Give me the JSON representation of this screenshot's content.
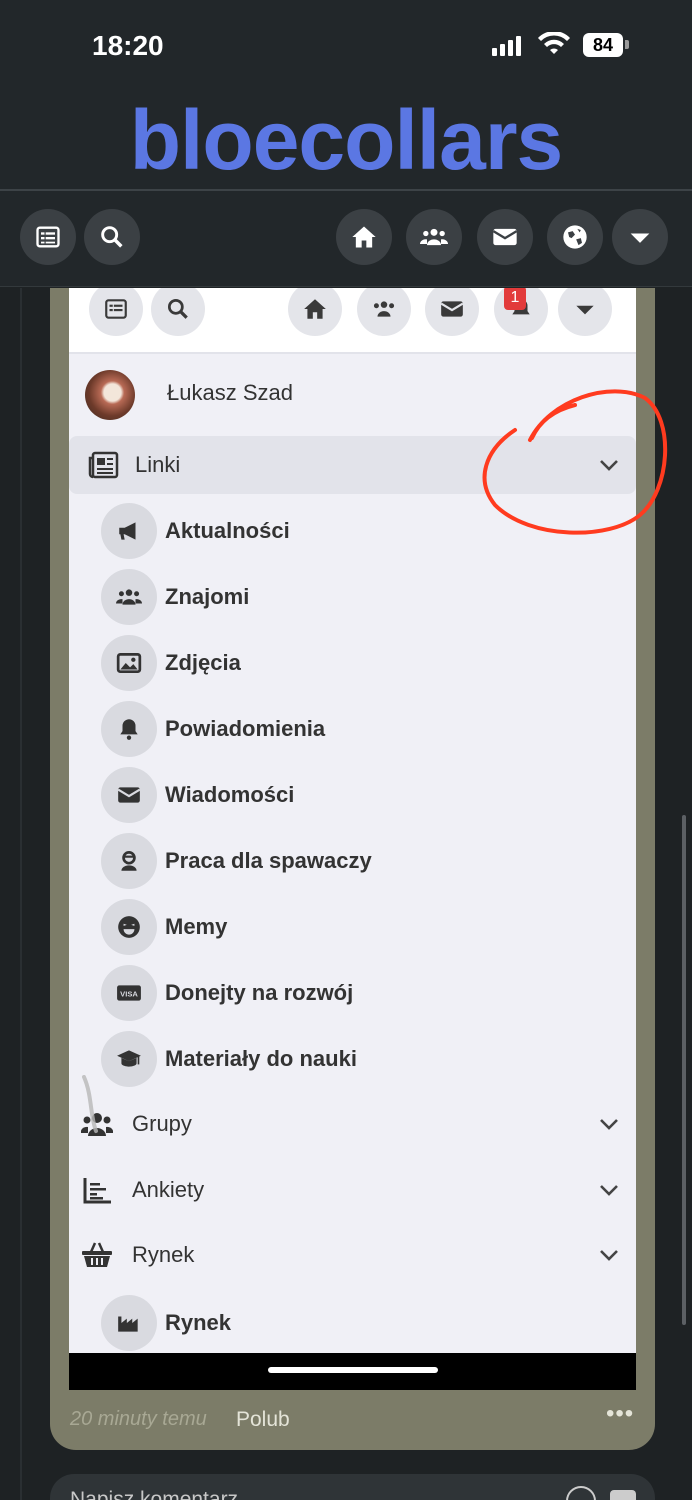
{
  "status_bar": {
    "time": "18:20",
    "battery": "84"
  },
  "brand": {
    "logo_text": "bloecollars",
    "color": "#5b77e3"
  },
  "top_nav": {
    "icons": [
      "list-icon",
      "search-icon",
      "home-icon",
      "friends-icon",
      "mail-icon",
      "globe-icon",
      "caret-down-icon"
    ]
  },
  "inner_nav": {
    "notification_badge": "1"
  },
  "profile": {
    "name": "Łukasz Szad"
  },
  "sections": {
    "linki": "Linki",
    "grupy": "Grupy",
    "ankiety": "Ankiety",
    "rynek": "Rynek"
  },
  "linki_items": [
    {
      "label": "Aktualności",
      "icon": "megaphone-icon"
    },
    {
      "label": "Znajomi",
      "icon": "friends-icon"
    },
    {
      "label": "Zdjęcia",
      "icon": "image-icon"
    },
    {
      "label": "Powiadomienia",
      "icon": "bell-icon"
    },
    {
      "label": "Wiadomości",
      "icon": "mail-icon"
    },
    {
      "label": "Praca dla spawaczy",
      "icon": "worker-icon"
    },
    {
      "label": "Memy",
      "icon": "laugh-icon"
    },
    {
      "label": "Donejty na rozwój",
      "icon": "visa-card-icon"
    },
    {
      "label": "Materiały do nauki",
      "icon": "graduation-cap-icon"
    }
  ],
  "rynek_items": [
    {
      "label": "Rynek",
      "icon": "factory-icon"
    }
  ],
  "post_meta": {
    "time": "20 minuty temu",
    "like": "Polub",
    "more": "•••"
  },
  "comment": {
    "placeholder": "Napisz komentarz..."
  },
  "annotation_color": "#ff3b1f"
}
